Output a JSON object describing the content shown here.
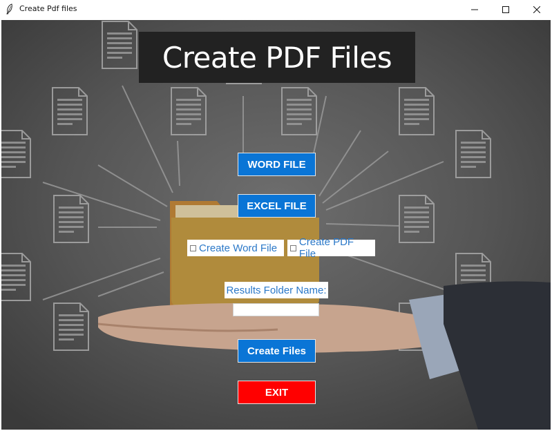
{
  "window": {
    "title": "Create Pdf files",
    "icons": {
      "app": "feather-icon",
      "minimize": "minimize-icon",
      "maximize": "maximize-icon",
      "close": "close-icon"
    }
  },
  "main": {
    "heading": "Create PDF Files",
    "buttons": {
      "word_file": "WORD FILE",
      "excel_file": "EXCEL FILE",
      "create_files": "Create Files",
      "exit": "EXIT"
    },
    "checkboxes": {
      "create_word": {
        "label": "Create Word File",
        "checked": false
      },
      "create_pdf": {
        "label": "Create PDF File",
        "checked": false
      }
    },
    "results_folder": {
      "label": "Results Folder Name:",
      "value": ""
    }
  },
  "colors": {
    "accent_blue": "#0a75d6",
    "exit_red": "#ff0000",
    "label_blue": "#2b78c8",
    "heading_bg": "#222222"
  }
}
